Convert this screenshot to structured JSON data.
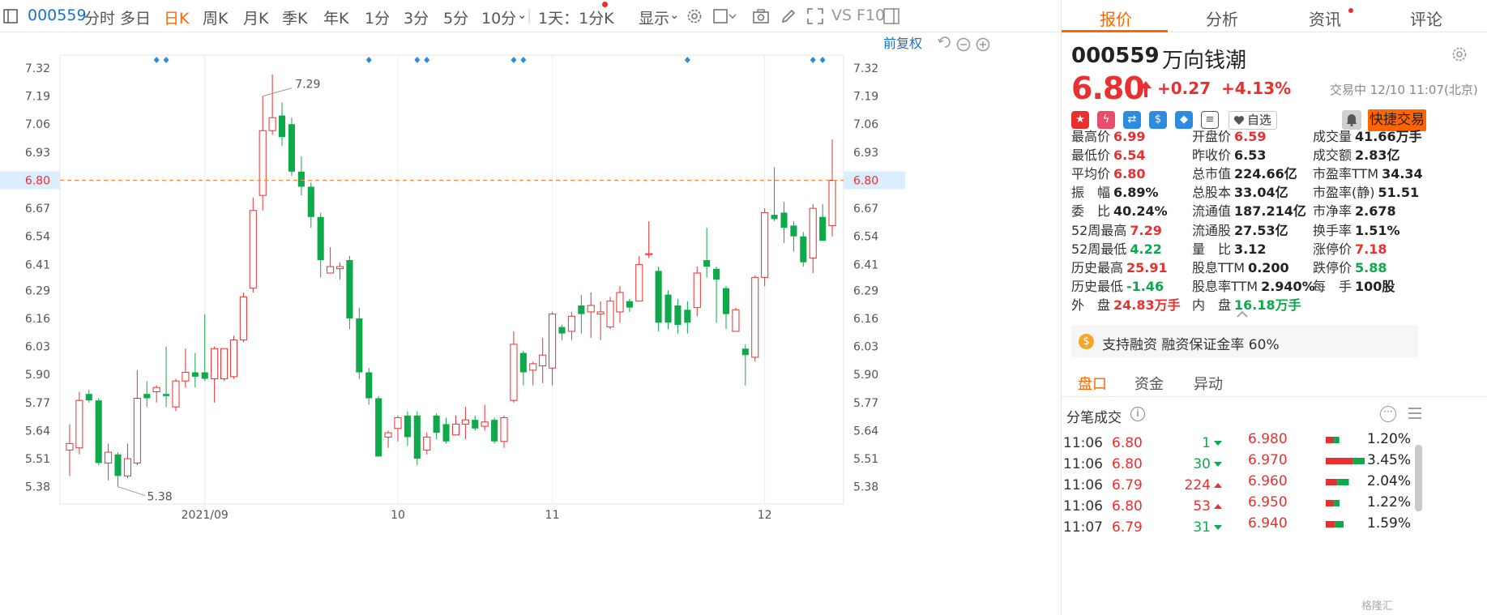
{
  "toolbar": {
    "code": "000559",
    "periods": [
      "分时",
      "多日",
      "日K",
      "周K",
      "月K",
      "季K",
      "年K",
      "1分",
      "3分",
      "5分",
      "10分"
    ],
    "active_period": "日K",
    "ten_min_arrow": "⌄",
    "interval": "1天：1分K",
    "display": "显示",
    "display_arrow": "⌄",
    "icon_names": [
      "settings-icon",
      "box-select-icon",
      "camera-icon",
      "pen-icon",
      "fullscreen-icon"
    ],
    "vs_label": "VS",
    "f10_label": "F10"
  },
  "chart_toolbar": {
    "adjust_label": "前复权"
  },
  "right_tabs": [
    "报价",
    "分析",
    "资讯",
    "评论"
  ],
  "right_active_tab": "报价",
  "stock": {
    "code": "000559",
    "name": "万向钱潮",
    "price": "6.80",
    "change": "+0.27",
    "change_pct": "+4.13%",
    "status": "交易中 12/10 11:07(北京)",
    "watch_label": "自选",
    "trade_label": "快捷交易"
  },
  "quote_stats": [
    [
      {
        "label": "最高价",
        "value": "6.99",
        "color": "red"
      },
      {
        "label": "开盘价",
        "value": "6.59",
        "color": "red"
      },
      {
        "label": "成交量",
        "value": "41.66万手",
        "color": "dark"
      }
    ],
    [
      {
        "label": "最低价",
        "value": "6.54",
        "color": "red"
      },
      {
        "label": "昨收价",
        "value": "6.53",
        "color": "dark"
      },
      {
        "label": "成交额",
        "value": "2.83亿",
        "color": "dark"
      }
    ],
    [
      {
        "label": "平均价",
        "value": "6.80",
        "color": "red"
      },
      {
        "label": "总市值",
        "value": "224.66亿",
        "color": "dark"
      },
      {
        "label": "市盈率TTM",
        "value": "34.34",
        "color": "dark"
      }
    ],
    [
      {
        "label": "振　幅",
        "value": "6.89%",
        "color": "dark"
      },
      {
        "label": "总股本",
        "value": "33.04亿",
        "color": "dark"
      },
      {
        "label": "市盈率(静)",
        "value": "51.51",
        "color": "dark"
      }
    ],
    [
      {
        "label": "委　比",
        "value": "40.24%",
        "color": "dark"
      },
      {
        "label": "流通值",
        "value": "187.214亿",
        "color": "dark"
      },
      {
        "label": "市净率",
        "value": "2.678",
        "color": "dark"
      }
    ],
    [
      {
        "label": "52周最高",
        "value": "7.29",
        "color": "red"
      },
      {
        "label": "流通股",
        "value": "27.53亿",
        "color": "dark"
      },
      {
        "label": "换手率",
        "value": "1.51%",
        "color": "dark"
      }
    ],
    [
      {
        "label": "52周最低",
        "value": "4.22",
        "color": "green"
      },
      {
        "label": "量　比",
        "value": "3.12",
        "color": "dark"
      },
      {
        "label": "涨停价",
        "value": "7.18",
        "color": "red"
      }
    ],
    [
      {
        "label": "历史最高",
        "value": "25.91",
        "color": "red"
      },
      {
        "label": "股息TTM",
        "value": "0.200",
        "color": "dark"
      },
      {
        "label": "跌停价",
        "value": "5.88",
        "color": "green"
      }
    ],
    [
      {
        "label": "历史最低",
        "value": "-1.46",
        "color": "green"
      },
      {
        "label": "股息率TTM",
        "value": "2.940%",
        "color": "dark"
      },
      {
        "label": "每　手",
        "value": "100股",
        "color": "dark"
      }
    ],
    [
      {
        "label": "外　盘",
        "value": "24.83万手",
        "color": "red"
      },
      {
        "label": "内　盘",
        "value": "16.18万手",
        "color": "green"
      },
      null
    ]
  ],
  "margin_notice": "支持融资 融资保证金率 60%",
  "sub_tabs": [
    "盘口",
    "资金",
    "异动"
  ],
  "sub_active_tab": "盘口",
  "trades_title": "分笔成交",
  "trades": [
    {
      "time": "11:06",
      "price": "6.80",
      "price_color": "red",
      "vol": "1",
      "dir": "down"
    },
    {
      "time": "11:06",
      "price": "6.80",
      "price_color": "red",
      "vol": "30",
      "dir": "down"
    },
    {
      "time": "11:06",
      "price": "6.79",
      "price_color": "red",
      "vol": "224",
      "dir": "up"
    },
    {
      "time": "11:06",
      "price": "6.80",
      "price_color": "red",
      "vol": "53",
      "dir": "up"
    },
    {
      "time": "11:07",
      "price": "6.79",
      "price_color": "red",
      "vol": "31",
      "dir": "down"
    }
  ],
  "price_dist": [
    {
      "price": "6.980",
      "pct": "1.20%",
      "red": 0.6,
      "green": 0.4
    },
    {
      "price": "6.970",
      "pct": "3.45%",
      "red": 0.7,
      "green": 0.3
    },
    {
      "price": "6.960",
      "pct": "2.04%",
      "red": 0.5,
      "green": 0.5
    },
    {
      "price": "6.950",
      "pct": "1.22%",
      "red": 0.6,
      "green": 0.4
    },
    {
      "price": "6.940",
      "pct": "1.59%",
      "red": 0.5,
      "green": 0.5
    }
  ],
  "watermark": "格隆汇",
  "chart_data": {
    "type": "candlestick",
    "ylim": [
      5.3,
      7.38
    ],
    "yticks": [
      "7.32",
      "7.19",
      "7.06",
      "6.93",
      "6.80",
      "6.67",
      "6.54",
      "6.41",
      "6.29",
      "6.16",
      "6.03",
      "5.90",
      "5.77",
      "5.64",
      "5.51",
      "5.38"
    ],
    "current_price": "6.80",
    "annotations": [
      {
        "label": "7.29",
        "kind": "max",
        "index": 20
      },
      {
        "label": "5.38",
        "kind": "min",
        "index": 5
      }
    ],
    "month_labels": [
      {
        "label": "2021/09",
        "index": 14
      },
      {
        "label": "10",
        "index": 34
      },
      {
        "label": "11",
        "index": 50
      },
      {
        "label": "12",
        "index": 72
      }
    ],
    "event_marker_indices": [
      9,
      10,
      31,
      36,
      37,
      46,
      47,
      64,
      77,
      78
    ],
    "up_color": "#e93030",
    "down_color": "#0ea94b",
    "candles": [
      {
        "o": 5.55,
        "c": 5.58,
        "h": 5.67,
        "l": 5.43
      },
      {
        "o": 5.56,
        "c": 5.78,
        "h": 5.82,
        "l": 5.53
      },
      {
        "o": 5.81,
        "c": 5.78,
        "h": 5.83,
        "l": 5.77
      },
      {
        "o": 5.78,
        "c": 5.49,
        "h": 5.79,
        "l": 5.48
      },
      {
        "o": 5.49,
        "c": 5.54,
        "h": 5.58,
        "l": 5.41
      },
      {
        "o": 5.53,
        "c": 5.43,
        "h": 5.54,
        "l": 5.38
      },
      {
        "o": 5.43,
        "c": 5.51,
        "h": 5.58,
        "l": 5.42
      },
      {
        "o": 5.49,
        "c": 5.79,
        "h": 5.92,
        "l": 5.48
      },
      {
        "o": 5.81,
        "c": 5.79,
        "h": 5.87,
        "l": 5.75
      },
      {
        "o": 5.82,
        "c": 5.84,
        "h": 5.85,
        "l": 5.77
      },
      {
        "o": 5.81,
        "c": 5.8,
        "h": 6.03,
        "l": 5.75
      },
      {
        "o": 5.75,
        "c": 5.87,
        "h": 5.88,
        "l": 5.73
      },
      {
        "o": 5.87,
        "c": 5.91,
        "h": 6.02,
        "l": 5.84
      },
      {
        "o": 5.91,
        "c": 5.89,
        "h": 6.0,
        "l": 5.84
      },
      {
        "o": 5.91,
        "c": 5.88,
        "h": 6.18,
        "l": 5.87
      },
      {
        "o": 5.88,
        "c": 6.02,
        "h": 6.03,
        "l": 5.77
      },
      {
        "o": 5.88,
        "c": 6.02,
        "h": 6.02,
        "l": 5.87
      },
      {
        "o": 5.89,
        "c": 6.06,
        "h": 6.08,
        "l": 5.88
      },
      {
        "o": 6.06,
        "c": 6.26,
        "h": 6.28,
        "l": 6.05
      },
      {
        "o": 6.3,
        "c": 6.66,
        "h": 6.72,
        "l": 6.28
      },
      {
        "o": 6.73,
        "c": 7.03,
        "h": 7.19,
        "l": 6.66
      },
      {
        "o": 7.03,
        "c": 7.09,
        "h": 7.29,
        "l": 7.01
      },
      {
        "o": 7.1,
        "c": 7.0,
        "h": 7.16,
        "l": 6.96
      },
      {
        "o": 7.06,
        "c": 6.84,
        "h": 7.09,
        "l": 6.82
      },
      {
        "o": 6.84,
        "c": 6.77,
        "h": 6.91,
        "l": 6.73
      },
      {
        "o": 6.77,
        "c": 6.63,
        "h": 6.79,
        "l": 6.58
      },
      {
        "o": 6.63,
        "c": 6.43,
        "h": 6.65,
        "l": 6.35
      },
      {
        "o": 6.37,
        "c": 6.4,
        "h": 6.49,
        "l": 6.37
      },
      {
        "o": 6.39,
        "c": 6.4,
        "h": 6.42,
        "l": 6.34
      },
      {
        "o": 6.43,
        "c": 6.16,
        "h": 6.45,
        "l": 6.11
      },
      {
        "o": 6.16,
        "c": 5.91,
        "h": 6.21,
        "l": 5.88
      },
      {
        "o": 5.91,
        "c": 5.79,
        "h": 5.93,
        "l": 5.76
      },
      {
        "o": 5.79,
        "c": 5.52,
        "h": 5.8,
        "l": 5.52
      },
      {
        "o": 5.61,
        "c": 5.63,
        "h": 5.64,
        "l": 5.56
      },
      {
        "o": 5.65,
        "c": 5.7,
        "h": 5.71,
        "l": 5.59
      },
      {
        "o": 5.71,
        "c": 5.61,
        "h": 5.73,
        "l": 5.57
      },
      {
        "o": 5.71,
        "c": 5.51,
        "h": 5.73,
        "l": 5.48
      },
      {
        "o": 5.55,
        "c": 5.61,
        "h": 5.63,
        "l": 5.53
      },
      {
        "o": 5.71,
        "c": 5.63,
        "h": 5.72,
        "l": 5.6
      },
      {
        "o": 5.67,
        "c": 5.59,
        "h": 5.7,
        "l": 5.58
      },
      {
        "o": 5.62,
        "c": 5.67,
        "h": 5.71,
        "l": 5.62
      },
      {
        "o": 5.67,
        "c": 5.69,
        "h": 5.75,
        "l": 5.6
      },
      {
        "o": 5.69,
        "c": 5.65,
        "h": 5.71,
        "l": 5.64
      },
      {
        "o": 5.66,
        "c": 5.68,
        "h": 5.76,
        "l": 5.64
      },
      {
        "o": 5.69,
        "c": 5.59,
        "h": 5.7,
        "l": 5.58
      },
      {
        "o": 5.59,
        "c": 5.7,
        "h": 5.71,
        "l": 5.56
      },
      {
        "o": 5.78,
        "c": 6.04,
        "h": 6.1,
        "l": 5.77
      },
      {
        "o": 6.0,
        "c": 5.91,
        "h": 6.01,
        "l": 5.85
      },
      {
        "o": 5.92,
        "c": 5.95,
        "h": 5.96,
        "l": 5.85
      },
      {
        "o": 5.94,
        "c": 5.99,
        "h": 6.07,
        "l": 5.86
      },
      {
        "o": 5.93,
        "c": 6.18,
        "h": 6.19,
        "l": 5.85
      },
      {
        "o": 6.12,
        "c": 6.09,
        "h": 6.13,
        "l": 6.06
      },
      {
        "o": 6.1,
        "c": 6.17,
        "h": 6.19,
        "l": 6.06
      },
      {
        "o": 6.22,
        "c": 6.18,
        "h": 6.27,
        "l": 6.09
      },
      {
        "o": 6.19,
        "c": 6.22,
        "h": 6.28,
        "l": 6.07
      },
      {
        "o": 6.18,
        "c": 6.19,
        "h": 6.24,
        "l": 6.06
      },
      {
        "o": 6.12,
        "c": 6.24,
        "h": 6.26,
        "l": 6.11
      },
      {
        "o": 6.19,
        "c": 6.28,
        "h": 6.31,
        "l": 6.14
      },
      {
        "o": 6.24,
        "c": 6.21,
        "h": 6.25,
        "l": 6.19
      },
      {
        "o": 6.24,
        "c": 6.41,
        "h": 6.45,
        "l": 6.24
      },
      {
        "o": 6.46,
        "c": 6.46,
        "h": 6.61,
        "l": 6.44
      },
      {
        "o": 6.38,
        "c": 6.14,
        "h": 6.4,
        "l": 6.1
      },
      {
        "o": 6.27,
        "c": 6.14,
        "h": 6.29,
        "l": 6.11
      },
      {
        "o": 6.22,
        "c": 6.13,
        "h": 6.25,
        "l": 6.09
      },
      {
        "o": 6.2,
        "c": 6.14,
        "h": 6.24,
        "l": 6.09
      },
      {
        "o": 6.21,
        "c": 6.37,
        "h": 6.4,
        "l": 6.17
      },
      {
        "o": 6.43,
        "c": 6.4,
        "h": 6.58,
        "l": 6.35
      },
      {
        "o": 6.39,
        "c": 6.34,
        "h": 6.4,
        "l": 6.14
      },
      {
        "o": 6.3,
        "c": 6.18,
        "h": 6.31,
        "l": 6.11
      },
      {
        "o": 6.1,
        "c": 6.2,
        "h": 6.21,
        "l": 6.1
      },
      {
        "o": 6.02,
        "c": 5.99,
        "h": 6.04,
        "l": 5.85
      },
      {
        "o": 5.98,
        "c": 6.35,
        "h": 6.36,
        "l": 5.96
      },
      {
        "o": 6.35,
        "c": 6.65,
        "h": 6.67,
        "l": 6.31
      },
      {
        "o": 6.64,
        "c": 6.62,
        "h": 6.86,
        "l": 6.61
      },
      {
        "o": 6.65,
        "c": 6.58,
        "h": 6.7,
        "l": 6.51
      },
      {
        "o": 6.59,
        "c": 6.54,
        "h": 6.61,
        "l": 6.47
      },
      {
        "o": 6.54,
        "c": 6.42,
        "h": 6.56,
        "l": 6.4
      },
      {
        "o": 6.44,
        "c": 6.67,
        "h": 6.69,
        "l": 6.37
      },
      {
        "o": 6.63,
        "c": 6.52,
        "h": 6.69,
        "l": 6.52
      },
      {
        "o": 6.59,
        "c": 6.8,
        "h": 6.99,
        "l": 6.54
      }
    ]
  }
}
